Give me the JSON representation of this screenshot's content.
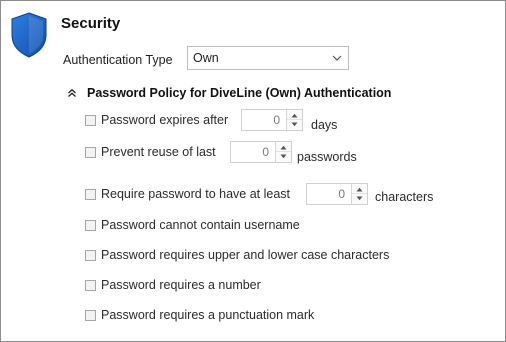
{
  "header": {
    "title": "Security",
    "icon": "shield-icon",
    "icon_color": "#1565c0"
  },
  "auth": {
    "label": "Authentication Type",
    "value": "Own"
  },
  "policy": {
    "heading": "Password Policy for DiveLine (Own) Authentication",
    "expires": {
      "label": "Password expires after",
      "value": "0",
      "unit": "days",
      "checked": false
    },
    "reuse": {
      "label": "Prevent reuse of last",
      "value": "0",
      "unit": "passwords",
      "checked": false
    },
    "min_length": {
      "label": "Require password to have at least",
      "value": "0",
      "unit": "characters",
      "checked": false
    },
    "no_username": {
      "label": "Password cannot contain username",
      "checked": false
    },
    "mixed_case": {
      "label": "Password requires upper and lower case characters",
      "checked": false
    },
    "number": {
      "label": "Password requires a number",
      "checked": false
    },
    "punctuation": {
      "label": "Password requires a punctuation mark",
      "checked": false
    }
  }
}
